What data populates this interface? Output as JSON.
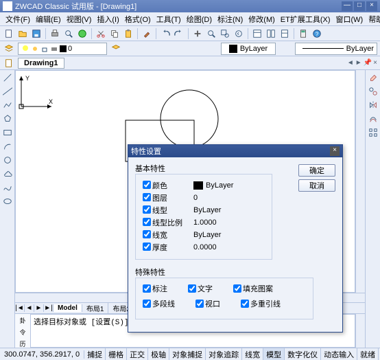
{
  "title": "ZWCAD Classic 试用版 - [Drawing1]",
  "menus": [
    "文件(F)",
    "编辑(E)",
    "视图(V)",
    "插入(I)",
    "格式(O)",
    "工具(T)",
    "绘图(D)",
    "标注(N)",
    "修改(M)",
    "ET扩展工具(X)",
    "窗口(W)",
    "帮助(H)"
  ],
  "layer_field": "0",
  "color_field": "ByLayer",
  "linetype_field": "ByLayer",
  "doc_tab": "Drawing1",
  "model_tabs": [
    "Model",
    "布局1",
    "布局2"
  ],
  "cmd_text": "选择目标对象或 [设置(S)]: s",
  "status_coords": "300.0747, 356.2917, 0",
  "status_buttons": [
    "捕捉",
    "栅格",
    "正交",
    "极轴",
    "对象捕捉",
    "对象追踪",
    "线宽",
    "模型",
    "数字化仪",
    "动态输入",
    "就绪"
  ],
  "dialog": {
    "title": "特性设置",
    "group1": "基本特性",
    "props": [
      {
        "label": "颜色",
        "value": "ByLayer",
        "swatch": true
      },
      {
        "label": "图层",
        "value": "0"
      },
      {
        "label": "线型",
        "value": "ByLayer"
      },
      {
        "label": "线型比例",
        "value": "1.0000"
      },
      {
        "label": "线宽",
        "value": "ByLayer"
      },
      {
        "label": "厚度",
        "value": "0.0000"
      }
    ],
    "group2": "特殊特性",
    "checks_row1": [
      "标注",
      "文字",
      "填充图案"
    ],
    "checks_row2": [
      "多段线",
      "视口",
      "多重引线"
    ],
    "ok": "确定",
    "cancel": "取消"
  },
  "chart_data": null
}
